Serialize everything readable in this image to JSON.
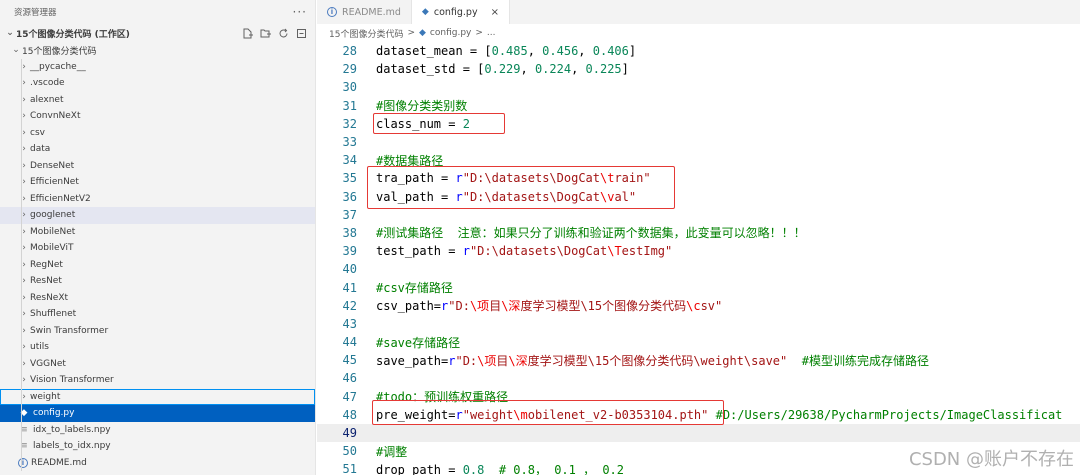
{
  "sidebar": {
    "title": "资源管理器",
    "more": "···",
    "workspace_label": "15个图像分类代码 (工作区)",
    "folder_label": "15个图像分类代码",
    "items": [
      {
        "label": "__pycache__",
        "type": "folder"
      },
      {
        "label": ".vscode",
        "type": "folder"
      },
      {
        "label": "alexnet",
        "type": "folder"
      },
      {
        "label": "ConvnNeXt",
        "type": "folder"
      },
      {
        "label": "csv",
        "type": "folder"
      },
      {
        "label": "data",
        "type": "folder"
      },
      {
        "label": "DenseNet",
        "type": "folder"
      },
      {
        "label": "EfficienNet",
        "type": "folder"
      },
      {
        "label": "EfficienNetV2",
        "type": "folder"
      },
      {
        "label": "googlenet",
        "type": "folder",
        "state": "hover"
      },
      {
        "label": "MobileNet",
        "type": "folder"
      },
      {
        "label": "MobileViT",
        "type": "folder"
      },
      {
        "label": "RegNet",
        "type": "folder"
      },
      {
        "label": "ResNet",
        "type": "folder"
      },
      {
        "label": "ResNeXt",
        "type": "folder"
      },
      {
        "label": "Shufflenet",
        "type": "folder"
      },
      {
        "label": "Swin Transformer",
        "type": "folder"
      },
      {
        "label": "utils",
        "type": "folder"
      },
      {
        "label": "VGGNet",
        "type": "folder"
      },
      {
        "label": "Vision Transformer",
        "type": "folder"
      },
      {
        "label": "weight",
        "type": "folder",
        "state": "outlined"
      },
      {
        "label": "config.py",
        "type": "python",
        "state": "selected"
      },
      {
        "label": "idx_to_labels.npy",
        "type": "file"
      },
      {
        "label": "labels_to_idx.npy",
        "type": "file"
      },
      {
        "label": "README.md",
        "type": "info"
      }
    ]
  },
  "tabs": [
    {
      "label": "README.md",
      "icon": "info-icon",
      "active": false
    },
    {
      "label": "config.py",
      "icon": "python-icon",
      "active": true,
      "close": "×"
    }
  ],
  "breadcrumb": {
    "folder": "15个图像分类代码",
    "sep1": ">",
    "file": "config.py",
    "sep2": ">",
    "tail": "..."
  },
  "code": [
    {
      "n": "28",
      "parts": [
        [
          "p",
          "dataset_mean = ["
        ],
        [
          "num",
          "0.485"
        ],
        [
          "p",
          ", "
        ],
        [
          "num",
          "0.456"
        ],
        [
          "p",
          ", "
        ],
        [
          "num",
          "0.406"
        ],
        [
          "p",
          "]"
        ]
      ]
    },
    {
      "n": "29",
      "parts": [
        [
          "p",
          "dataset_std = ["
        ],
        [
          "num",
          "0.229"
        ],
        [
          "p",
          ", "
        ],
        [
          "num",
          "0.224"
        ],
        [
          "p",
          ", "
        ],
        [
          "num",
          "0.225"
        ],
        [
          "p",
          "]"
        ]
      ]
    },
    {
      "n": "30",
      "parts": []
    },
    {
      "n": "31",
      "parts": [
        [
          "com",
          "#图像分类类别数"
        ]
      ]
    },
    {
      "n": "32",
      "parts": [
        [
          "p",
          "class_num = "
        ],
        [
          "num",
          "2"
        ]
      ]
    },
    {
      "n": "33",
      "parts": []
    },
    {
      "n": "34",
      "parts": [
        [
          "com",
          "#数据集路径"
        ]
      ]
    },
    {
      "n": "35",
      "parts": [
        [
          "p",
          "tra_path = "
        ],
        [
          "pre",
          "r"
        ],
        [
          "str",
          "\"D:\\datasets\\DogCat"
        ],
        [
          "esc",
          "\\t"
        ],
        [
          "str",
          "rain\""
        ]
      ]
    },
    {
      "n": "36",
      "parts": [
        [
          "p",
          "val_path = "
        ],
        [
          "pre",
          "r"
        ],
        [
          "str",
          "\"D:\\datasets\\DogCat"
        ],
        [
          "esc",
          "\\v"
        ],
        [
          "str",
          "al\""
        ]
      ]
    },
    {
      "n": "37",
      "parts": []
    },
    {
      "n": "38",
      "parts": [
        [
          "com",
          "#测试集路径  注意：如果只分了训练和验证两个数据集，此变量可以忽略！！！"
        ]
      ]
    },
    {
      "n": "39",
      "parts": [
        [
          "p",
          "test_path = "
        ],
        [
          "pre",
          "r"
        ],
        [
          "str",
          "\"D:\\datasets\\DogCat"
        ],
        [
          "esc",
          "\\T"
        ],
        [
          "str",
          "estImg\""
        ]
      ]
    },
    {
      "n": "40",
      "parts": []
    },
    {
      "n": "41",
      "parts": [
        [
          "com",
          "#csv存储路径"
        ]
      ]
    },
    {
      "n": "42",
      "parts": [
        [
          "p",
          "csv_path="
        ],
        [
          "pre",
          "r"
        ],
        [
          "str",
          "\"D:"
        ],
        [
          "esc",
          "\\项"
        ],
        [
          "str",
          "目"
        ],
        [
          "esc",
          "\\深"
        ],
        [
          "str",
          "度学习模型\\15个图像分类代码"
        ],
        [
          "esc",
          "\\c"
        ],
        [
          "str",
          "sv\""
        ]
      ]
    },
    {
      "n": "43",
      "parts": []
    },
    {
      "n": "44",
      "parts": [
        [
          "com",
          "#save存储路径"
        ]
      ]
    },
    {
      "n": "45",
      "parts": [
        [
          "p",
          "save_path="
        ],
        [
          "pre",
          "r"
        ],
        [
          "str",
          "\"D:"
        ],
        [
          "esc",
          "\\项"
        ],
        [
          "str",
          "目"
        ],
        [
          "esc",
          "\\深"
        ],
        [
          "str",
          "度学习模型\\15个图像分类代码\\weight\\save\""
        ],
        [
          "p",
          "  "
        ],
        [
          "com",
          "#模型训练完成存储路径"
        ]
      ]
    },
    {
      "n": "46",
      "parts": []
    },
    {
      "n": "47",
      "parts": [
        [
          "com",
          "#todo：预训练权重路径"
        ]
      ]
    },
    {
      "n": "48",
      "parts": [
        [
          "p",
          "pre_weight="
        ],
        [
          "pre",
          "r"
        ],
        [
          "str",
          "\"weight"
        ],
        [
          "esc",
          "\\m"
        ],
        [
          "str",
          "obilenet_v2-b0353104.pth\""
        ],
        [
          "p",
          " "
        ],
        [
          "com",
          "#D:/Users/29638/PycharmProjects/ImageClassificat"
        ]
      ]
    },
    {
      "n": "49",
      "parts": [],
      "current": true
    },
    {
      "n": "50",
      "parts": [
        [
          "com",
          "#调整"
        ]
      ]
    },
    {
      "n": "51",
      "parts": [
        [
          "p",
          "drop_path = "
        ],
        [
          "num",
          "0.8"
        ],
        [
          "p",
          "  "
        ],
        [
          "com",
          "# 0.8， 0.1 ， 0.2"
        ]
      ]
    }
  ],
  "watermark": "CSDN @账户不存在",
  "highlight_color": "#e53935"
}
